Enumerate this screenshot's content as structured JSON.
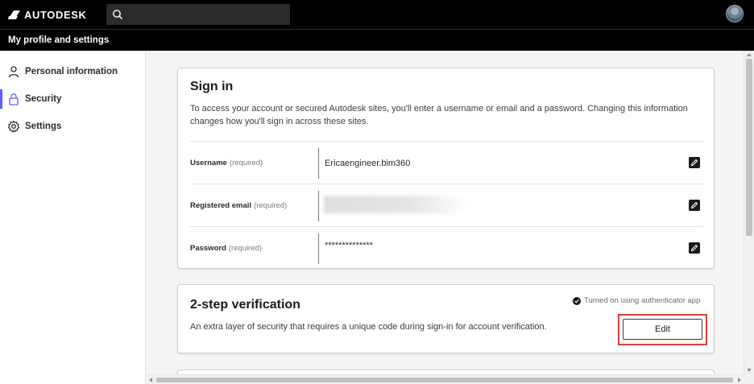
{
  "topbar": {
    "brand": "AUTODESK",
    "logo_icon": "autodesk-logo",
    "search_icon": "search-icon",
    "search_placeholder": "",
    "avatar_icon": "user-avatar"
  },
  "subbar": {
    "title": "My profile and settings"
  },
  "sidebar": {
    "items": [
      {
        "label": "Personal information",
        "icon": "person-icon",
        "active": false
      },
      {
        "label": "Security",
        "icon": "lock-icon",
        "active": true
      },
      {
        "label": "Settings",
        "icon": "gear-icon",
        "active": false
      }
    ]
  },
  "signin": {
    "title": "Sign in",
    "description": "To access your account or secured Autodesk sites, you'll enter a username or email and a password. Changing this information changes how you'll sign in across these sites.",
    "rows": [
      {
        "label": "Username",
        "required": "(required)",
        "value": "Ericaengineer.bim360",
        "edit_icon": "pencil-icon"
      },
      {
        "label": "Registered email",
        "required": "(required)",
        "value": "",
        "edit_icon": "pencil-icon"
      },
      {
        "label": "Password",
        "required": "(required)",
        "value": "**************",
        "edit_icon": "pencil-icon"
      }
    ]
  },
  "two_step": {
    "title": "2-step verification",
    "description": "An extra layer of security that requires a unique code during sign-in for account verification.",
    "status": "Turned on using authenticator app",
    "status_icon": "check-circle-icon",
    "edit_label": "Edit"
  },
  "colors": {
    "topbar_bg": "#000000",
    "active_accent": "#5f60ff",
    "highlight": "#d9403e"
  }
}
